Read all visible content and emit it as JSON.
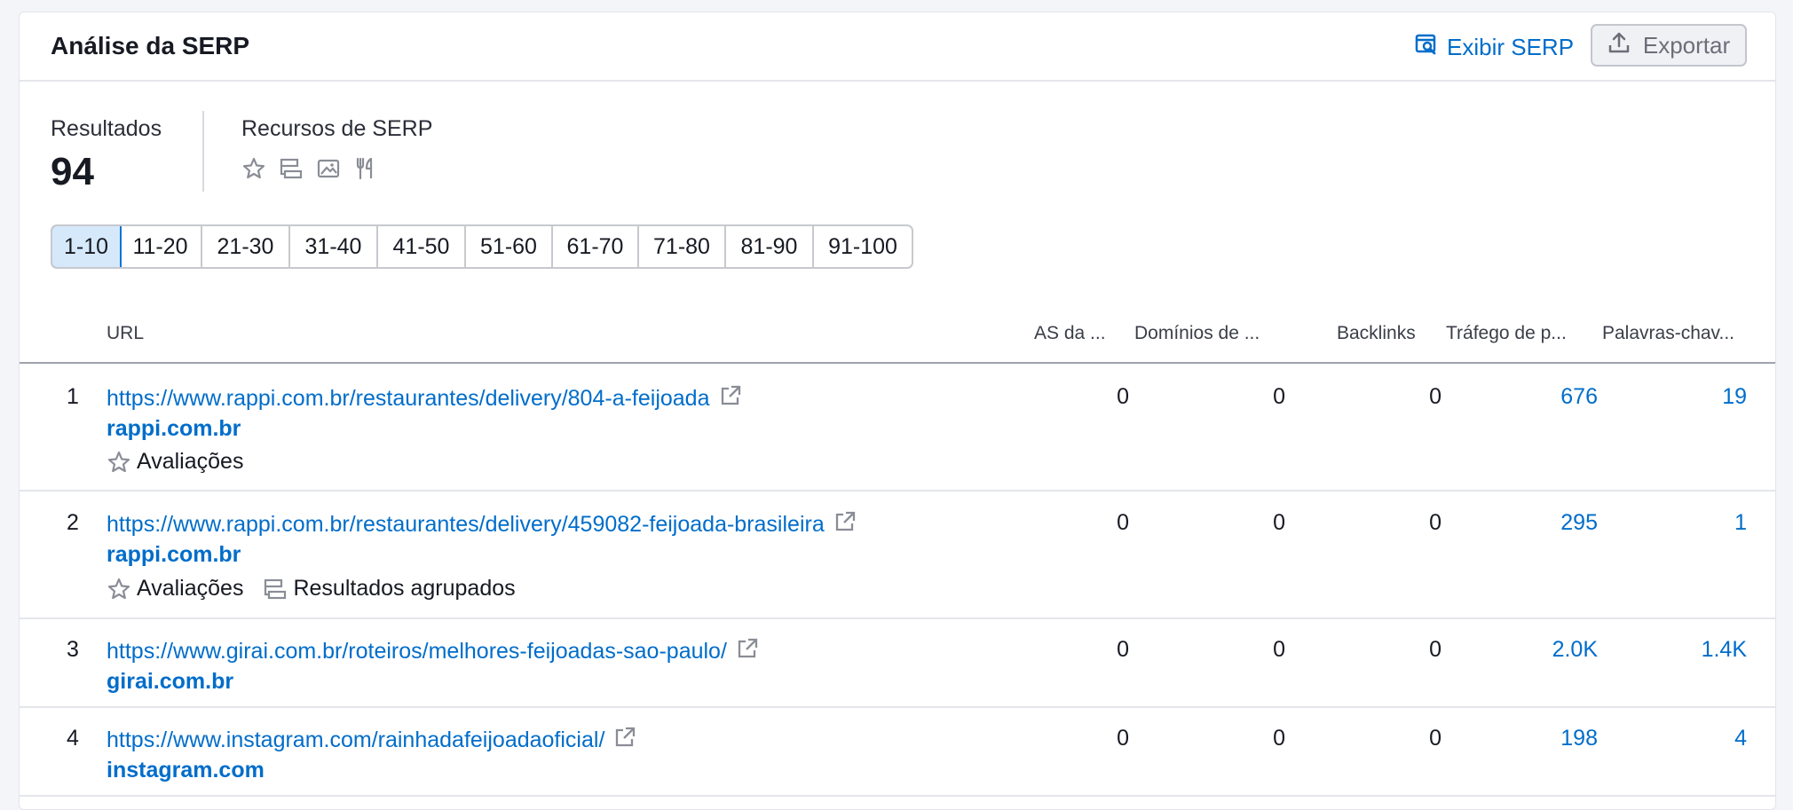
{
  "header": {
    "title": "Análise da SERP",
    "view_serp_label": "Exibir SERP",
    "export_label": "Exportar"
  },
  "summary": {
    "results_label": "Resultados",
    "results_value": "94",
    "features_label": "Recursos de SERP",
    "feature_icons": [
      "star-icon",
      "grouped-results-icon",
      "image-icon",
      "restaurant-icon"
    ]
  },
  "pagination": {
    "pages": [
      "1-10",
      "11-20",
      "21-30",
      "31-40",
      "41-50",
      "51-60",
      "61-70",
      "71-80",
      "81-90",
      "91-100"
    ],
    "active": "1-10"
  },
  "table": {
    "columns": {
      "url": "URL",
      "as": "AS da ...",
      "domains": "Domínios de ...",
      "backlinks": "Backlinks",
      "traffic": "Tráfego de p...",
      "keywords": "Palavras-chav..."
    },
    "rows": [
      {
        "position": "1",
        "url": "https://www.rappi.com.br/restaurantes/delivery/804-a-feijoada",
        "domain": "rappi.com.br",
        "features": [
          "Avaliações"
        ],
        "as": "0",
        "domains": "0",
        "backlinks": "0",
        "traffic": "676",
        "keywords": "19"
      },
      {
        "position": "2",
        "url": "https://www.rappi.com.br/restaurantes/delivery/459082-feijoada-brasileira",
        "domain": "rappi.com.br",
        "features": [
          "Avaliações",
          "Resultados agrupados"
        ],
        "as": "0",
        "domains": "0",
        "backlinks": "0",
        "traffic": "295",
        "keywords": "1"
      },
      {
        "position": "3",
        "url": "https://www.girai.com.br/roteiros/melhores-feijoadas-sao-paulo/",
        "domain": "girai.com.br",
        "features": [],
        "as": "0",
        "domains": "0",
        "backlinks": "0",
        "traffic": "2.0K",
        "keywords": "1.4K"
      },
      {
        "position": "4",
        "url": "https://www.instagram.com/rainhadafeijoadaoficial/",
        "domain": "instagram.com",
        "features": [],
        "as": "0",
        "domains": "0",
        "backlinks": "0",
        "traffic": "198",
        "keywords": "4"
      }
    ]
  },
  "colors": {
    "link": "#006dca",
    "active_page_bg": "#d6e9fb",
    "active_page_border": "#0e74d6"
  }
}
